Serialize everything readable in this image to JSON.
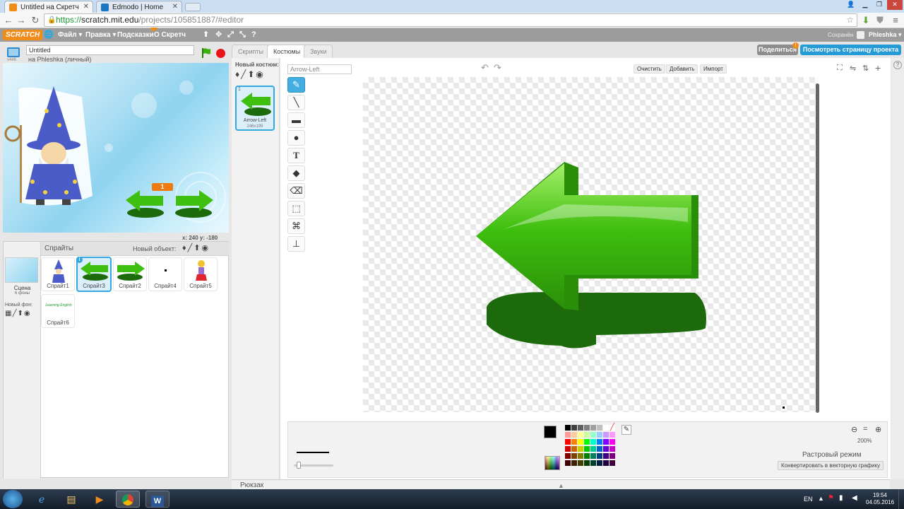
{
  "browser": {
    "tabs": [
      {
        "title": "Untitled на Скретч",
        "active": true,
        "favicon_color": "#f08c1a"
      },
      {
        "title": "Edmodo | Home",
        "active": false,
        "favicon_color": "#1a78c2"
      }
    ],
    "url_prefix": "https://",
    "url_host": "scratch.mit.edu",
    "url_path": "/projects/105851887/#editor"
  },
  "scratch_menu": {
    "logo": "SCRATCH",
    "items": [
      "Файл ▾",
      "Правка ▾",
      "Подсказки",
      "О Скретч"
    ],
    "save_status": "Сохранён",
    "username": "Phleshka ▾"
  },
  "project": {
    "title": "Untitled",
    "owner": "на Phleshka (личный)",
    "version": "v446"
  },
  "stage": {
    "counter": "1",
    "coords": "x: 240  y: -180"
  },
  "sprites_pane": {
    "title": "Спрайты",
    "new_object_label": "Новый объект:",
    "scene_label": "Сцена",
    "scene_count": "6 фоны",
    "new_backdrop_label": "Новый фон:",
    "sprites": [
      {
        "name": "Спрайт1",
        "selected": false
      },
      {
        "name": "Спрайт3",
        "selected": true
      },
      {
        "name": "Спрайт2",
        "selected": false
      },
      {
        "name": "Спрайт4",
        "selected": false
      },
      {
        "name": "Спрайт5",
        "selected": false
      },
      {
        "name": "Спрайт6",
        "selected": false
      }
    ],
    "sprite6_text": "Learning English"
  },
  "editor_tabs": [
    "Скрипты",
    "Костюмы",
    "Звуки"
  ],
  "share_button": "Поделиться",
  "project_page_button": "Посмотреть страницу проекта",
  "costumes": {
    "new_costume_label": "Новый костюм:",
    "items": [
      {
        "index": "1",
        "name": "Arrow-Left",
        "size": "246x199"
      }
    ]
  },
  "paint_editor": {
    "costume_name_value": "Arrow-Left",
    "clear_button": "Очистить",
    "add_button": "Добавить",
    "import_button": "Импорт",
    "zoom_level": "200%",
    "mode_label": "Растровый режим",
    "convert_button": "Конвертировать в векторную графику",
    "tools": [
      "brush-icon",
      "line-icon",
      "rectangle-icon",
      "ellipse-icon",
      "text-icon",
      "fill-icon",
      "eraser-icon",
      "select-icon",
      "select-remove-background-icon",
      "stamp-icon"
    ],
    "primary_color": "#000000",
    "palette": [
      "#000000",
      "#404040",
      "#606060",
      "#808080",
      "#a0a0a0",
      "#c0c0c0",
      "#ffffff",
      "#ffffff",
      "#ff9999",
      "#ffcc99",
      "#ffff99",
      "#ccff99",
      "#99ffcc",
      "#99ccff",
      "#cc99ff",
      "#ff99ff",
      "#ff0000",
      "#ff8000",
      "#ffff00",
      "#00ff00",
      "#00ffcc",
      "#0080ff",
      "#8000ff",
      "#ff00ff",
      "#cc0000",
      "#cc6600",
      "#cccc00",
      "#00cc00",
      "#00cc99",
      "#0066cc",
      "#6600cc",
      "#cc00cc",
      "#800000",
      "#804000",
      "#808000",
      "#008000",
      "#008060",
      "#004080",
      "#400080",
      "#800080",
      "#400000",
      "#402000",
      "#404000",
      "#004000",
      "#004030",
      "#002040",
      "#200040",
      "#400040"
    ]
  },
  "backpack_label": "Рюкзак",
  "taskbar": {
    "language": "EN",
    "time": "19:54",
    "date": "04.05.2016"
  },
  "colors": {
    "scratch_blue": "#249bd6",
    "menubar_gray": "#9c9c9c",
    "arrow_green": "#3fbf0f",
    "shadow_green": "#1c6a0c"
  }
}
